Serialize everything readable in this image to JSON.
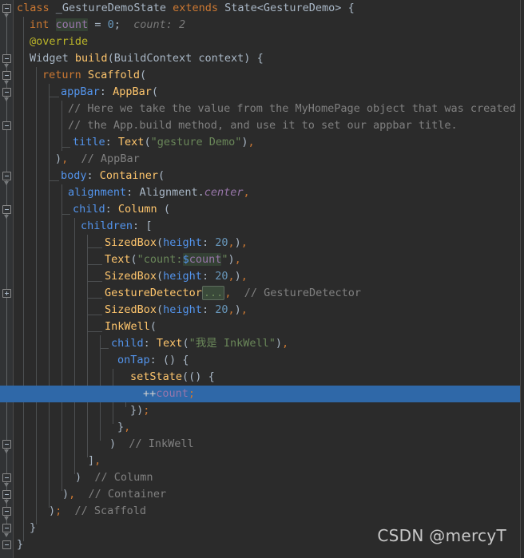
{
  "editor": {
    "background": "#2B2B2B",
    "gutter_background": "#313335",
    "selection_color": "#2F68A8",
    "default_text_color": "#A9B7C6",
    "line_height_px": 21,
    "selected_line_index": 23
  },
  "watermark": {
    "text": "CSDN @mercyT",
    "color": "#C8C8C8"
  },
  "code": {
    "language": "dart",
    "lines": [
      {
        "index": 0,
        "indent": 0,
        "text": "class _GestureDemoState extends State<GestureDemo> {"
      },
      {
        "index": 1,
        "indent": 1,
        "text": "int count = 0;   count: 2"
      },
      {
        "index": 2,
        "indent": 1,
        "text": "@override"
      },
      {
        "index": 3,
        "indent": 1,
        "text": "Widget build(BuildContext context) {"
      },
      {
        "index": 4,
        "indent": 2,
        "text": "return Scaffold("
      },
      {
        "index": 5,
        "indent": 3,
        "text": "appBar: AppBar("
      },
      {
        "index": 6,
        "indent": 4,
        "text": "// Here we take the value from the MyHomePage object that was created by"
      },
      {
        "index": 7,
        "indent": 4,
        "text": "// the App.build method, and use it to set our appbar title."
      },
      {
        "index": 8,
        "indent": 4,
        "text": "title: Text(\"gesture Demo\"),"
      },
      {
        "index": 9,
        "indent": 3,
        "text": "),  // AppBar"
      },
      {
        "index": 10,
        "indent": 3,
        "text": "body: Container("
      },
      {
        "index": 11,
        "indent": 4,
        "text": "alignment: Alignment.center,"
      },
      {
        "index": 12,
        "indent": 4,
        "text": "child: Column ("
      },
      {
        "index": 13,
        "indent": 5,
        "text": "children: ["
      },
      {
        "index": 14,
        "indent": 6,
        "text": "SizedBox(height: 20,),"
      },
      {
        "index": 15,
        "indent": 6,
        "text": "Text(\"count:$count\"),"
      },
      {
        "index": 16,
        "indent": 6,
        "text": "SizedBox(height: 20,),"
      },
      {
        "index": 17,
        "indent": 6,
        "text": "GestureDetector(...),  // GestureDetector"
      },
      {
        "index": 18,
        "indent": 6,
        "text": "SizedBox(height: 20,),"
      },
      {
        "index": 19,
        "indent": 6,
        "text": "InkWell("
      },
      {
        "index": 20,
        "indent": 7,
        "text": "child: Text(\"我是 InkWell\"),"
      },
      {
        "index": 21,
        "indent": 7,
        "text": "onTap: () {"
      },
      {
        "index": 22,
        "indent": 8,
        "text": "setState(() {"
      },
      {
        "index": 23,
        "indent": 9,
        "text": "++count;"
      },
      {
        "index": 24,
        "indent": 8,
        "text": "});"
      },
      {
        "index": 25,
        "indent": 7,
        "text": "},"
      },
      {
        "index": 26,
        "indent": 6,
        "text": ")  // InkWell"
      },
      {
        "index": 27,
        "indent": 5,
        "text": "],"
      },
      {
        "index": 28,
        "indent": 4,
        "text": ")  // Column"
      },
      {
        "index": 29,
        "indent": 3,
        "text": "),  // Container"
      },
      {
        "index": 30,
        "indent": 2,
        "text": ");  // Scaffold"
      },
      {
        "index": 31,
        "indent": 1,
        "text": "}"
      },
      {
        "index": 32,
        "indent": 0,
        "text": "}"
      }
    ],
    "inline_hints": [
      {
        "line": 1,
        "text": "count: 2"
      }
    ],
    "folded_regions": [
      {
        "line": 17,
        "placeholder": "(...)",
        "owner": "GestureDetector"
      }
    ],
    "usage_highlights": [
      {
        "line": 1,
        "token": "count"
      },
      {
        "line": 15,
        "token": "count"
      }
    ],
    "closing_comments": [
      {
        "line": 9,
        "text": "// AppBar"
      },
      {
        "line": 17,
        "text": "// GestureDetector"
      },
      {
        "line": 26,
        "text": "// InkWell"
      },
      {
        "line": 28,
        "text": "// Column"
      },
      {
        "line": 29,
        "text": "// Container"
      },
      {
        "line": 30,
        "text": "// Scaffold"
      }
    ]
  },
  "gutter": {
    "fold_markers": [
      {
        "line": 0,
        "state": "expanded"
      },
      {
        "line": 3,
        "state": "expanded"
      },
      {
        "line": 4,
        "state": "expanded"
      },
      {
        "line": 5,
        "state": "expanded"
      },
      {
        "line": 7,
        "state": "expanded"
      },
      {
        "line": 10,
        "state": "expanded"
      },
      {
        "line": 12,
        "state": "expanded"
      },
      {
        "line": 17,
        "state": "collapsed"
      },
      {
        "line": 26,
        "state": "expanded"
      },
      {
        "line": 28,
        "state": "expanded"
      },
      {
        "line": 29,
        "state": "expanded"
      },
      {
        "line": 30,
        "state": "expanded"
      },
      {
        "line": 31,
        "state": "expanded"
      },
      {
        "line": 32,
        "state": "expanded"
      }
    ]
  },
  "colors": {
    "keyword": "#CC7832",
    "function": "#FFC66D",
    "string": "#6A8759",
    "number": "#6897BB",
    "comment": "#808080",
    "annotation": "#BBB529",
    "field": "#9876AA",
    "named_arg": "#5394EC",
    "inline_hint": "#787878",
    "usage_highlight_bg": "#344134",
    "folded_bg": "#3A4A3A"
  }
}
